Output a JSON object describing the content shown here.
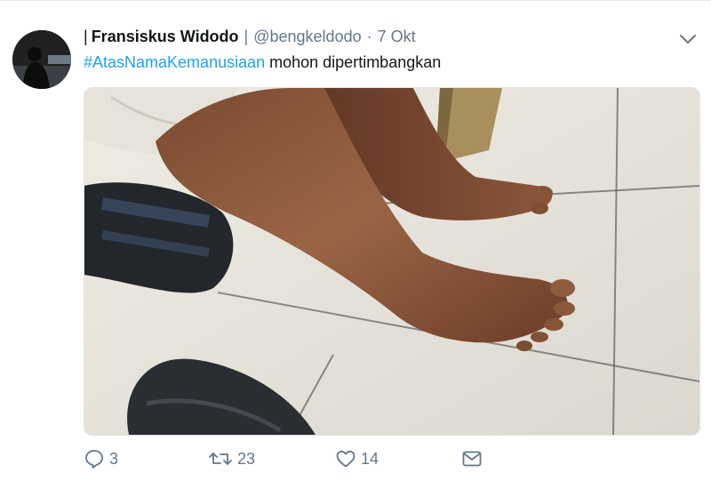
{
  "tweet": {
    "prefix_bar": "|",
    "display_name": "Fransiskus Widodo",
    "name_separator": "|",
    "handle": "@bengkeldodo",
    "dot": "·",
    "timestamp": "7 Okt",
    "hashtag": "#AtasNamaKemanusiaan",
    "text_rest": " mohon dipertimbangkan",
    "avatar_icon": "avatar-silhouette",
    "menu_icon": "chevron-down-icon",
    "media_description": "photo"
  },
  "actions": {
    "reply": {
      "icon": "reply-icon",
      "count": "3"
    },
    "retweet": {
      "icon": "retweet-icon",
      "count": "23"
    },
    "like": {
      "icon": "heart-icon",
      "count": "14"
    },
    "dm": {
      "icon": "envelope-icon"
    }
  },
  "colors": {
    "accent": "#1da1f2",
    "secondary_text": "#657786",
    "primary_text": "#14171a"
  }
}
